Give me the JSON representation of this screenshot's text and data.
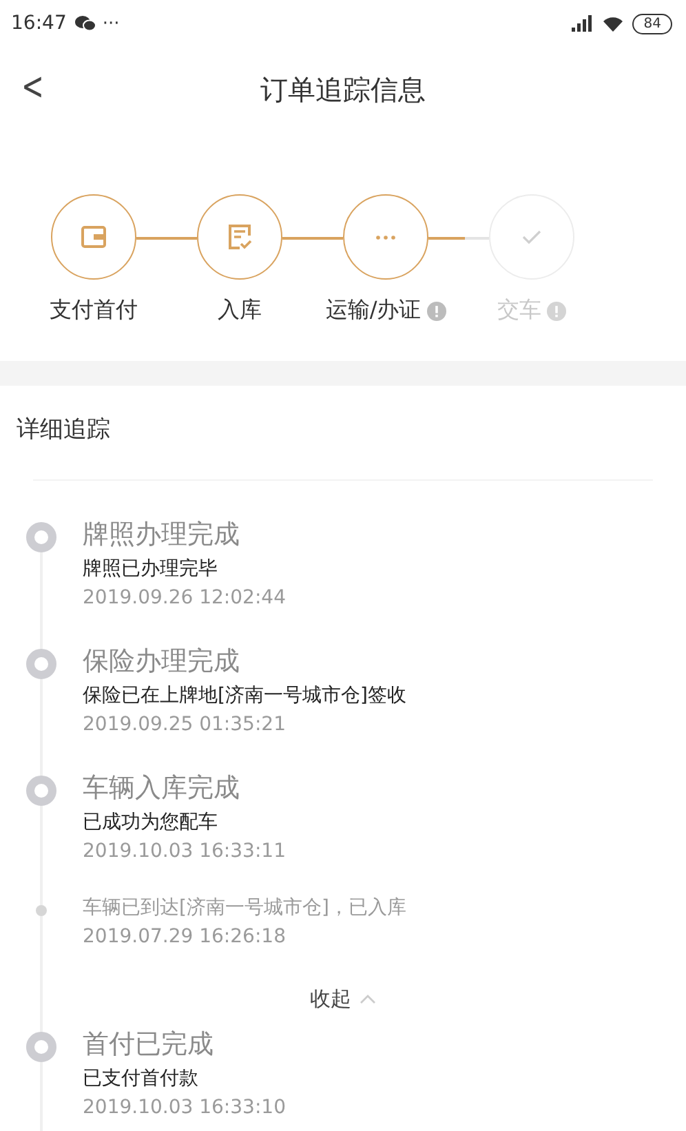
{
  "status_bar": {
    "time": "16:47",
    "more": "···",
    "battery": "84"
  },
  "nav": {
    "back": "<",
    "title": "订单追踪信息"
  },
  "steps": [
    {
      "label": "支付首付",
      "active": true,
      "current": false,
      "info": false
    },
    {
      "label": "入库",
      "active": true,
      "current": false,
      "info": false
    },
    {
      "label": "运输/办证",
      "active": true,
      "current": true,
      "info": true
    },
    {
      "label": "交车",
      "active": false,
      "current": false,
      "info": true
    }
  ],
  "section_title": "详细追踪",
  "events": [
    {
      "kind": "major",
      "title": "牌照办理完成",
      "detail": "牌照已办理完毕",
      "time": "2019.09.26 12:02:44"
    },
    {
      "kind": "major",
      "title": "保险办理完成",
      "detail": "保险已在上牌地[济南一号城市仓]签收",
      "time": "2019.09.25 01:35:21"
    },
    {
      "kind": "major",
      "title": "车辆入库完成",
      "detail": "已成功为您配车",
      "time": "2019.10.03 16:33:11"
    },
    {
      "kind": "minor",
      "detail": "车辆已到达[济南一号城市仓]，已入库",
      "time": "2019.07.29 16:26:18"
    },
    {
      "kind": "collapse",
      "label": "收起",
      "expanded": true
    },
    {
      "kind": "major",
      "title": "首付已完成",
      "detail": "已支付首付款",
      "time": "2019.10.03 16:33:10"
    }
  ]
}
